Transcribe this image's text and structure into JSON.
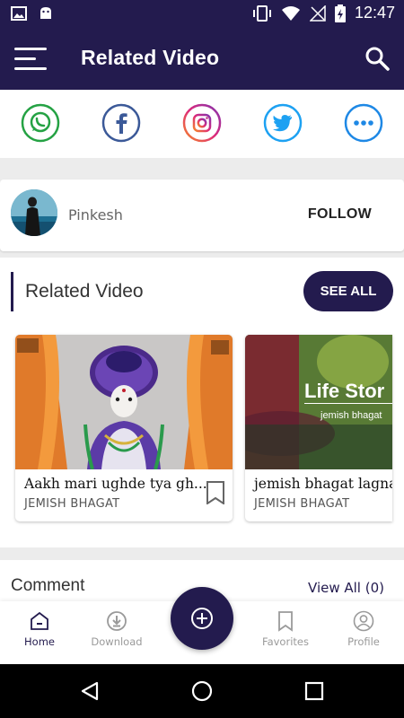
{
  "status_bar": {
    "time": "12:47",
    "left_icons": [
      "image-icon",
      "android-icon"
    ],
    "right_icons": [
      "vibrate-icon",
      "wifi-icon",
      "no-signal-icon",
      "battery-charging-icon"
    ]
  },
  "header": {
    "title": "Related Video",
    "background": "#231b4e"
  },
  "share": {
    "items": [
      {
        "name": "whatsapp",
        "color": "#25a244"
      },
      {
        "name": "facebook",
        "color": "#3b5998"
      },
      {
        "name": "instagram",
        "color": "#c13584"
      },
      {
        "name": "twitter",
        "color": "#1da1f2"
      },
      {
        "name": "more",
        "color": "#1e88e5"
      }
    ]
  },
  "profile": {
    "name": "Pinkesh",
    "follow_label": "FOLLOW"
  },
  "related": {
    "title": "Related Video",
    "see_all_label": "SEE ALL",
    "videos": [
      {
        "title": "Aakh mari ughde tya gh...",
        "channel": "JEMISH BHAGAT",
        "thumb_overlay": ""
      },
      {
        "title": "jemish bhagat lagna",
        "channel": "JEMISH BHAGAT",
        "thumb_overlay": "Life Stor",
        "thumb_sub": "jemish bhagat"
      }
    ]
  },
  "comments": {
    "title": "Comment",
    "view_all_label": "View All (0)"
  },
  "bottom_nav": {
    "items": [
      {
        "label": "Home",
        "active": true
      },
      {
        "label": "Download",
        "active": false
      },
      {
        "label": "Favorites",
        "active": false
      },
      {
        "label": "Profile",
        "active": false
      }
    ]
  },
  "colors": {
    "primary": "#231b4e",
    "inactive": "#9a9a9a"
  }
}
